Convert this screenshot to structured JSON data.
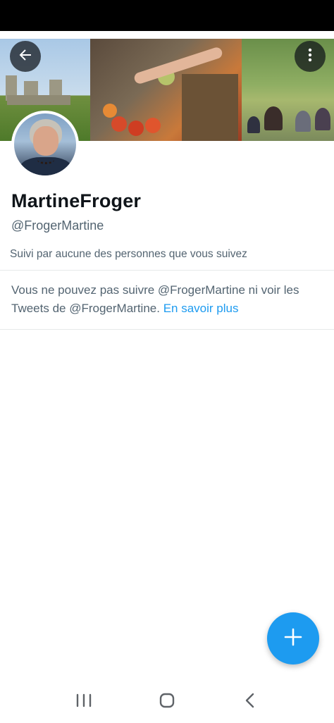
{
  "profile": {
    "display_name": "MartineFroger",
    "handle": "@FrogerMartine",
    "followed_by": "Suivi par aucune des personnes que vous suivez"
  },
  "protected_notice": {
    "text": "Vous ne pouvez pas suivre @FrogerMartine ni voir les Tweets de @FrogerMartine.",
    "link_label": "En savoir plus"
  },
  "icons": {
    "back": "arrow-left-icon",
    "more": "more-vertical-icon",
    "compose": "plus-icon",
    "nav_recents": "recents-icon",
    "nav_home": "home-icon",
    "nav_back": "back-chevron-icon"
  },
  "colors": {
    "accent": "#1d9bf0",
    "text_primary": "#0f1419",
    "text_secondary": "#536471",
    "divider": "#e7e9ea"
  }
}
